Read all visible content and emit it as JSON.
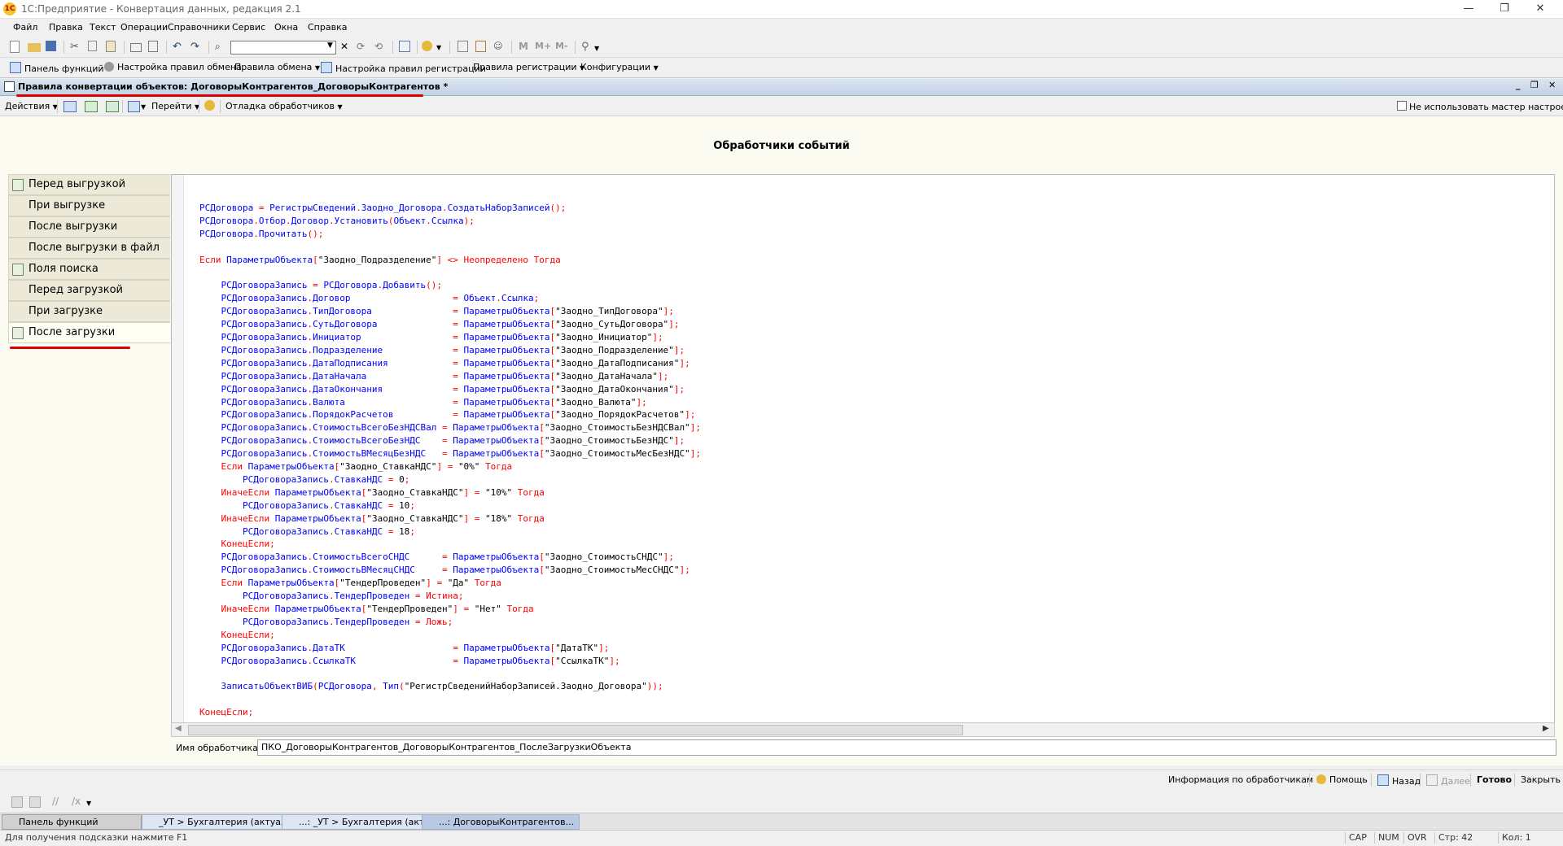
{
  "window": {
    "title": "1С:Предприятие - Конвертация данных, редакция 2.1",
    "logo": "1С"
  },
  "menu": [
    "Файл",
    "Правка",
    "Текст",
    "Операции",
    "Справочники",
    "Сервис",
    "Окна",
    "Справка"
  ],
  "toolbar2": [
    "Панель функций",
    "Настройка правил обмена",
    "Правила обмена",
    "Настройка правил регистрации",
    "Правила регистрации",
    "Конфигурации"
  ],
  "inner_window": {
    "title": "Правила конвертации объектов: ДоговорыКонтрагентов_ДоговорыКонтрагентов *"
  },
  "actions": {
    "actions_label": "Действия",
    "goto_label": "Перейти",
    "debug_label": "Отладка обработчиков",
    "wizard_checkbox": "Не использовать мастер настроек"
  },
  "heading": "Обработчики событий",
  "nav": [
    {
      "label": "Перед выгрузкой",
      "icon": true
    },
    {
      "label": "При выгрузке",
      "icon": false
    },
    {
      "label": "После выгрузки",
      "icon": false
    },
    {
      "label": "После выгрузки в файл",
      "icon": false
    },
    {
      "label": "Поля поиска",
      "icon": true
    },
    {
      "label": "Перед загрузкой",
      "icon": false
    },
    {
      "label": "При загрузке",
      "icon": false
    },
    {
      "label": "После загрузки",
      "icon": true,
      "active": true
    }
  ],
  "code_lines": [
    "",
    "РСДоговора = РегистрыСведений.Заодно_Договора.СоздатьНаборЗаписей();",
    "РСДоговора.Отбор.Договор.Установить(Объект.Ссылка);",
    "РСДоговора.Прочитать();",
    "",
    "Если ПараметрыОбъекта[\"Заодно_Подразделение\"] <> Неопределено Тогда",
    "",
    "    РСДоговораЗапись = РСДоговора.Добавить();",
    "    РСДоговораЗапись.Договор                   = Объект.Ссылка;",
    "    РСДоговораЗапись.ТипДоговора               = ПараметрыОбъекта[\"Заодно_ТипДоговора\"];",
    "    РСДоговораЗапись.СутьДоговора              = ПараметрыОбъекта[\"Заодно_СутьДоговора\"];",
    "    РСДоговораЗапись.Инициатор                 = ПараметрыОбъекта[\"Заодно_Инициатор\"];",
    "    РСДоговораЗапись.Подразделение             = ПараметрыОбъекта[\"Заодно_Подразделение\"];",
    "    РСДоговораЗапись.ДатаПодписания            = ПараметрыОбъекта[\"Заодно_ДатаПодписания\"];",
    "    РСДоговораЗапись.ДатаНачала                = ПараметрыОбъекта[\"Заодно_ДатаНачала\"];",
    "    РСДоговораЗапись.ДатаОкончания             = ПараметрыОбъекта[\"Заодно_ДатаОкончания\"];",
    "    РСДоговораЗапись.Валюта                    = ПараметрыОбъекта[\"Заодно_Валюта\"];",
    "    РСДоговораЗапись.ПорядокРасчетов           = ПараметрыОбъекта[\"Заодно_ПорядокРасчетов\"];",
    "    РСДоговораЗапись.СтоимостьВсегоБезНДСВал = ПараметрыОбъекта[\"Заодно_СтоимостьБезНДСВал\"];",
    "    РСДоговораЗапись.СтоимостьВсегоБезНДС    = ПараметрыОбъекта[\"Заодно_СтоимостьБезНДС\"];",
    "    РСДоговораЗапись.СтоимостьВМесяцБезНДС   = ПараметрыОбъекта[\"Заодно_СтоимостьМесБезНДС\"];",
    "    Если ПараметрыОбъекта[\"Заодно_СтавкаНДС\"] = \"0%\" Тогда",
    "        РСДоговораЗапись.СтавкаНДС = 0;",
    "    ИначеЕсли ПараметрыОбъекта[\"Заодно_СтавкаНДС\"] = \"10%\" Тогда",
    "        РСДоговораЗапись.СтавкаНДС = 10;",
    "    ИначеЕсли ПараметрыОбъекта[\"Заодно_СтавкаНДС\"] = \"18%\" Тогда",
    "        РСДоговораЗапись.СтавкаНДС = 18;",
    "    КонецЕсли;",
    "    РСДоговораЗапись.СтоимостьВсегоСНДС      = ПараметрыОбъекта[\"Заодно_СтоимостьСНДС\"];",
    "    РСДоговораЗапись.СтоимостьВМесяцСНДС     = ПараметрыОбъекта[\"Заодно_СтоимостьМесСНДС\"];",
    "    Если ПараметрыОбъекта[\"ТендерПроведен\"] = \"Да\" Тогда",
    "        РСДоговораЗапись.ТендерПроведен = Истина;",
    "    ИначеЕсли ПараметрыОбъекта[\"ТендерПроведен\"] = \"Нет\" Тогда",
    "        РСДоговораЗапись.ТендерПроведен = Ложь;",
    "    КонецЕсли;",
    "    РСДоговораЗапись.ДатаТК                    = ПараметрыОбъекта[\"ДатаТК\"];",
    "    РСДоговораЗапись.СсылкаТК                  = ПараметрыОбъекта[\"СсылкаТК\"];",
    "",
    "    ЗаписатьОбъектВИБ(РСДоговора, Тип(\"РегистрСведенийНаборЗаписей.Заодно_Договора\"));",
    "",
    "КонецЕсли;"
  ],
  "handler": {
    "label": "Имя обработчика:",
    "value": "ПКО_ДоговорыКонтрагентов_ДоговорыКонтрагентов_ПослеЗагрузкиОбъекта"
  },
  "bottom": {
    "info": "Информация по обработчикам ...",
    "help": "Помощь",
    "back": "Назад",
    "next": "Далее",
    "done": "Готово",
    "close": "Закрыть"
  },
  "tasks": [
    {
      "label": "Панель функций",
      "active": false
    },
    {
      "label": "_УТ > Бухгалтерия (актуал...",
      "active": false
    },
    {
      "label": "...: _УТ > Бухгалтерия (акту...",
      "active": false
    },
    {
      "label": "...: ДоговорыКонтрагентов...",
      "active": true
    }
  ],
  "status": {
    "hint": "Для получения подсказки нажмите F1",
    "cap": "CAP",
    "num": "NUM",
    "ovr": "OVR",
    "line": "Стр: 42",
    "col": "Кол: 1"
  },
  "colors": {
    "keyword": "#ff0000",
    "identifier": "#0000ff",
    "literal": "#000000",
    "accent_underline": "#d80000"
  }
}
